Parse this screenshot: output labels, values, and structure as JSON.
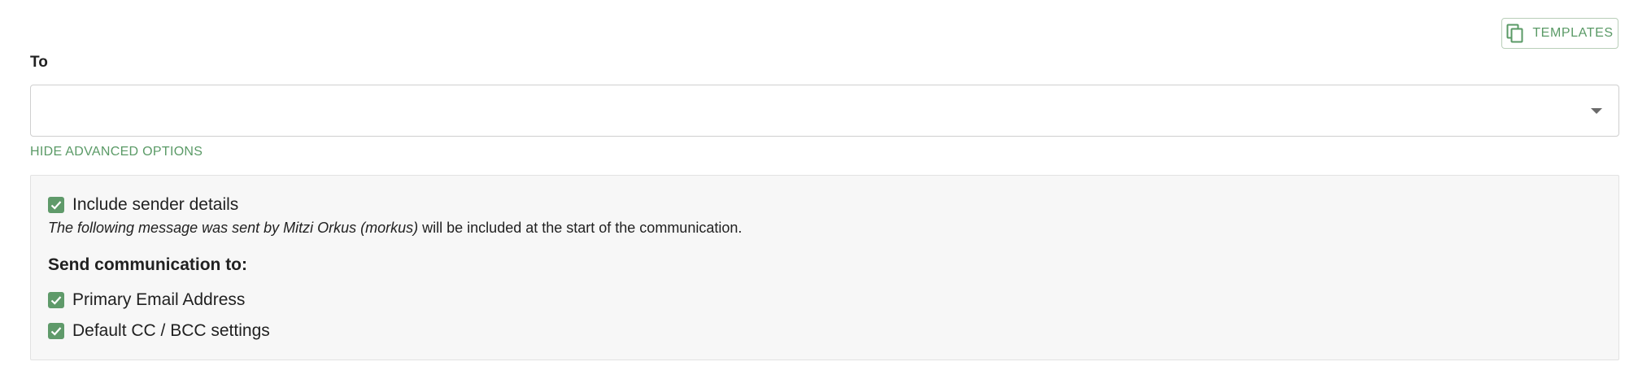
{
  "toolbar": {
    "templates_label": "TEMPLATES",
    "templates_icon": "copy-icon"
  },
  "to_field": {
    "label": "To",
    "value": ""
  },
  "advanced_toggle": {
    "label": "HIDE ADVANCED OPTIONS"
  },
  "advanced": {
    "include_sender": {
      "label": "Include sender details",
      "checked": true
    },
    "sender_note": {
      "italic_part": "The following message was sent by Mitzi Orkus (morkus)",
      "rest": " will be included at the start of the communication."
    },
    "send_to_heading": "Send communication to:",
    "options": [
      {
        "label": "Primary Email Address",
        "checked": true
      },
      {
        "label": "Default CC / BCC settings",
        "checked": true
      }
    ]
  },
  "colors": {
    "accent": "#5a9a66",
    "checkbox": "#5f9a6a",
    "panel_bg": "#f7f7f7"
  }
}
